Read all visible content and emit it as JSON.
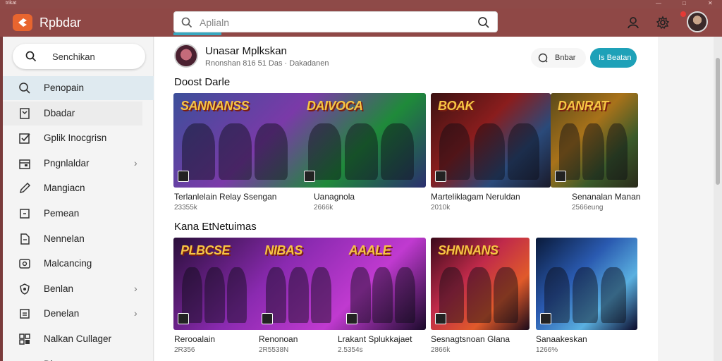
{
  "window": {
    "small_title": "trikat"
  },
  "topbar": {
    "app_title": "Rpbdar",
    "search_placeholder": "Aplialn"
  },
  "sidebar": {
    "search_label": "Senchikan",
    "items": [
      {
        "label": "Penopain",
        "icon": "search-icon",
        "chevron": false
      },
      {
        "label": "Dbadar",
        "icon": "bookmark-icon",
        "chevron": false
      },
      {
        "label": "Gplik Inocgrisn",
        "icon": "check-square-icon",
        "chevron": false
      },
      {
        "label": "Pngnlaldar",
        "icon": "calendar-icon",
        "chevron": true
      },
      {
        "label": "Mangiacn",
        "icon": "pencil-icon",
        "chevron": false
      },
      {
        "label": "Pemean",
        "icon": "square-icon",
        "chevron": false
      },
      {
        "label": "Nennelan",
        "icon": "document-icon",
        "chevron": false
      },
      {
        "label": "Malcancing",
        "icon": "image-icon",
        "chevron": false
      },
      {
        "label": "Benlan",
        "icon": "shield-icon",
        "chevron": true
      },
      {
        "label": "Denelan",
        "icon": "list-icon",
        "chevron": true
      },
      {
        "label": "Nalkan Cullager",
        "icon": "grid-icon",
        "chevron": false
      },
      {
        "label": "Dlnaaa",
        "icon": "folder-icon",
        "chevron": false
      }
    ]
  },
  "main": {
    "title": "Unasar Mplkskan",
    "subtitle": "Rnonshan 816  51 Das · Dakadanen",
    "secondary_button": "Bnbar",
    "primary_button": "Is Beatan",
    "sections": [
      {
        "title": "Doost Darle",
        "cards": [
          {
            "title": "Terlanlelain Relay Ssengan",
            "meta": "23355k",
            "banner": "SANNANSS",
            "colors": [
              "#3c4f9a",
              "#7a3aa8",
              "#1f8a3a",
              "#2b2f6f"
            ]
          },
          {
            "title": "Uanagnola",
            "meta": "2666k",
            "banner": "DAIVOCA",
            "colors": [
              "#2b2f6f",
              "#6a2a92",
              "#2c9a4a",
              "#19235a"
            ]
          },
          {
            "title": "Marteliklagam Neruldan",
            "meta": "2010k",
            "banner": "BOAK",
            "colors": [
              "#3b1212",
              "#8a1d1d",
              "#2a4a7a",
              "#1a1a2a"
            ]
          },
          {
            "title": "Senanalan Manan",
            "meta": "2566eung",
            "banner": "DANRAT",
            "colors": [
              "#5a4a1a",
              "#a8721a",
              "#3a5a2a",
              "#2a2a1a"
            ]
          }
        ]
      },
      {
        "title": "Kana EtNetuimas",
        "cards": [
          {
            "title": "Rerooalain",
            "meta": "2R356",
            "banner": "PLBCSE",
            "colors": [
              "#2a0f3a",
              "#8a2ab0",
              "#c03ad0",
              "#1a0a2a"
            ]
          },
          {
            "title": "Renonoan",
            "meta": "2R5538N",
            "banner": "NIBAS",
            "colors": [
              "#6a4a1a",
              "#d07a1a",
              "#3a7a2a",
              "#2a3a1a"
            ]
          },
          {
            "title": "Lrakant Splukkajaet",
            "meta": "2.5354s",
            "banner": "AAALE",
            "colors": [
              "#4a7aa0",
              "#c8a040",
              "#3a8a3a",
              "#2a4a3a"
            ]
          },
          {
            "title": "Sesnagtsnoan Glana",
            "meta": "2866k",
            "banner": "SHNNANS",
            "colors": [
              "#3a0a1a",
              "#c02a4a",
              "#e05a2a",
              "#1a0a1a"
            ]
          },
          {
            "title": "Sanaakeskan",
            "meta": "1266%",
            "banner": "",
            "colors": [
              "#0a1a3a",
              "#2a5ab0",
              "#5ab0e0",
              "#0a0a2a"
            ]
          }
        ]
      }
    ]
  }
}
